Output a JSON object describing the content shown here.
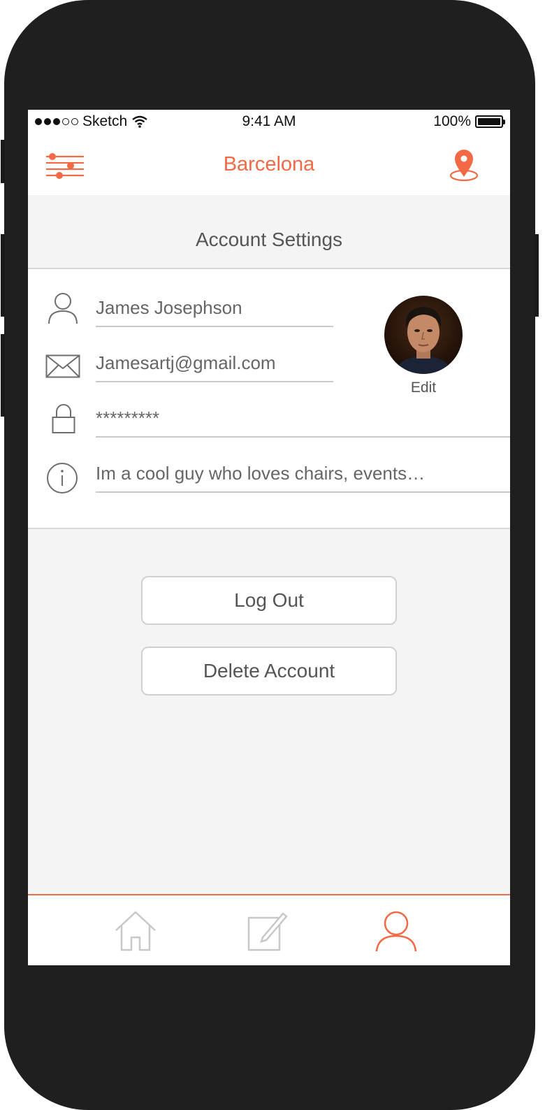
{
  "status_bar": {
    "carrier": "Sketch",
    "time": "9:41 AM",
    "battery": "100%"
  },
  "nav": {
    "title": "Barcelona",
    "left_icon": "filter-sliders-icon",
    "right_icon": "location-pin-icon"
  },
  "page": {
    "section_title": "Account Settings"
  },
  "form": {
    "name": "James Josephson",
    "email": "Jamesartj@gmail.com",
    "password": "*********",
    "bio": "Im a cool guy who loves chairs, events…",
    "icons": [
      "user-icon",
      "mail-icon",
      "lock-icon",
      "info-icon"
    ]
  },
  "avatar": {
    "edit_label": "Edit"
  },
  "actions": {
    "logout_label": "Log Out",
    "delete_label": "Delete Account"
  },
  "tabbar": {
    "tabs": [
      {
        "icon": "home-icon",
        "active": false
      },
      {
        "icon": "compose-icon",
        "active": false
      },
      {
        "icon": "profile-icon",
        "active": true
      }
    ]
  },
  "colors": {
    "accent": "#f26a45",
    "background": "#f4f4f4",
    "text": "#555555",
    "phone_body": "#1f1f1f"
  }
}
